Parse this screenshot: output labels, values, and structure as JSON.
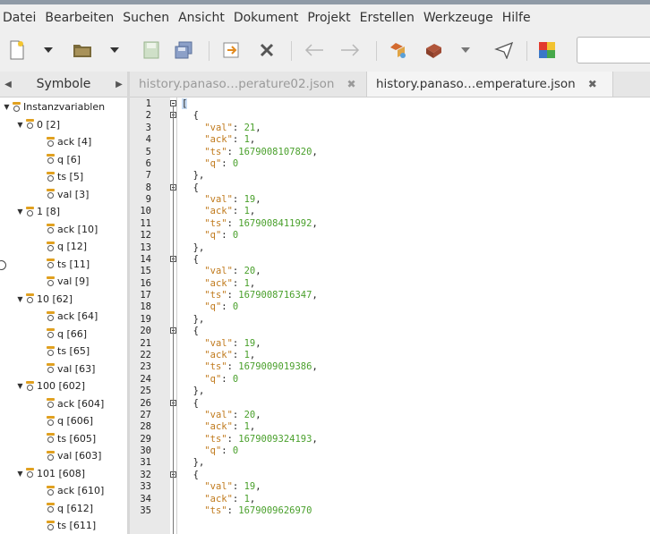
{
  "menu": [
    "Datei",
    "Bearbeiten",
    "Suchen",
    "Ansicht",
    "Dokument",
    "Projekt",
    "Erstellen",
    "Werkzeuge",
    "Hilfe"
  ],
  "sidebar": {
    "tab_label": "Symbole",
    "root": "Instanzvariablen",
    "groups": [
      {
        "label": "0 [2]",
        "children": [
          "ack [4]",
          "q [6]",
          "ts [5]",
          "val [3]"
        ]
      },
      {
        "label": "1 [8]",
        "children": [
          "ack [10]",
          "q [12]",
          "ts [11]",
          "val [9]"
        ]
      },
      {
        "label": "10 [62]",
        "children": [
          "ack [64]",
          "q [66]",
          "ts [65]",
          "val [63]"
        ]
      },
      {
        "label": "100 [602]",
        "children": [
          "ack [604]",
          "q [606]",
          "ts [605]",
          "val [603]"
        ]
      },
      {
        "label": "101 [608]",
        "children": [
          "ack [610]",
          "q [612]",
          "ts [611]"
        ]
      }
    ]
  },
  "tabs": [
    {
      "label": "history.panaso…perature02.json",
      "active": false
    },
    {
      "label": "history.panaso…emperature.json",
      "active": true
    }
  ],
  "code": {
    "records": [
      {
        "val": "21",
        "ack": "1",
        "ts": "1679008107820",
        "q": "0"
      },
      {
        "val": "19",
        "ack": "1",
        "ts": "1679008411992",
        "q": "0"
      },
      {
        "val": "20",
        "ack": "1",
        "ts": "1679008716347",
        "q": "0"
      },
      {
        "val": "19",
        "ack": "1",
        "ts": "1679009019386",
        "q": "0"
      },
      {
        "val": "20",
        "ack": "1",
        "ts": "1679009324193",
        "q": "0"
      },
      {
        "val": "19",
        "ack": "1",
        "ts": "1679009626970"
      }
    ],
    "line_count": 35
  },
  "colors": {
    "key": "#c07a1c",
    "number": "#4aa02c",
    "accent": "#3877d8"
  },
  "icons": [
    "new-file-icon",
    "dropdown-icon",
    "open-folder-icon",
    "save-icon",
    "save-all-icon",
    "revert-icon",
    "close-file-icon",
    "back-arrow-icon",
    "forward-arrow-icon",
    "compile-icon",
    "build-icon",
    "run-icon",
    "color-chooser-icon"
  ]
}
